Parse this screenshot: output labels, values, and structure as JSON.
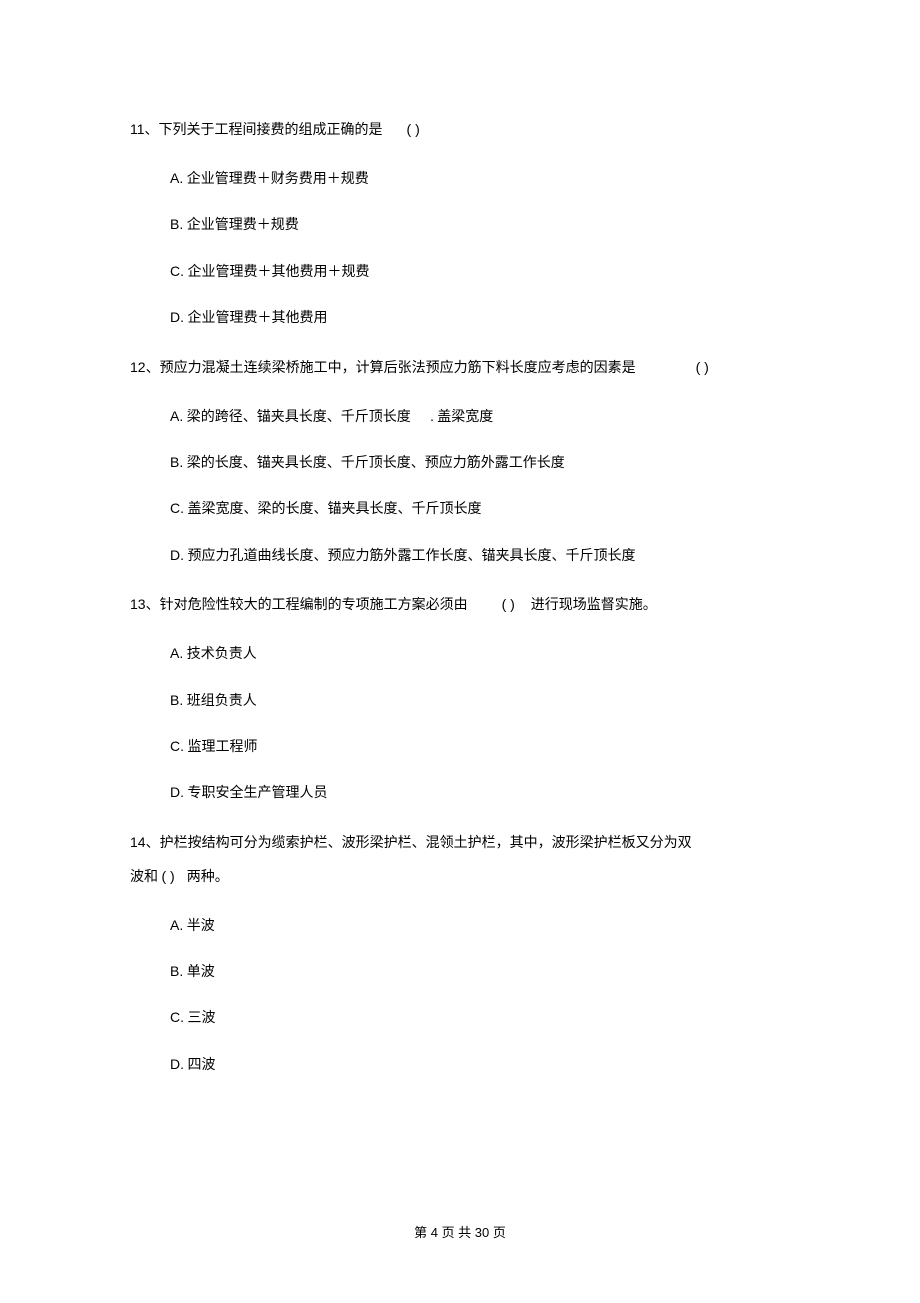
{
  "questions": [
    {
      "number": "11",
      "sep": "、",
      "stem_before": "下列关于工程间接费的组成正确的是",
      "blank": "(    )",
      "stem_after": "",
      "options": [
        {
          "letter": "A.",
          "text": "企业管理费＋财务费用＋规费"
        },
        {
          "letter": "B.",
          "text": "企业管理费＋规费"
        },
        {
          "letter": "C.",
          "text": "企业管理费＋其他费用＋规费"
        },
        {
          "letter": "D.",
          "text": "企业管理费＋其他费用"
        }
      ]
    },
    {
      "number": "12",
      "sep": "、",
      "stem_before": "预应力混凝土连续梁桥施工中，计算后张法预应力筋下料长度应考虑的因素是",
      "blank": "(    )",
      "stem_after": "",
      "options": [
        {
          "letter": "A.",
          "text": "梁的跨径、锚夹具长度、千斤顶长度",
          "extra": "   . 盖梁宽度"
        },
        {
          "letter": "B.",
          "text": "梁的长度、锚夹具长度、千斤顶长度、预应力筋外露工作长度"
        },
        {
          "letter": "C.",
          "text": "盖梁宽度、梁的长度、锚夹具长度、千斤顶长度"
        },
        {
          "letter": "D.",
          "text": "预应力孔道曲线长度、预应力筋外露工作长度、锚夹具长度、千斤顶长度"
        }
      ]
    },
    {
      "number": "13",
      "sep": "、",
      "stem_before": "针对危险性较大的工程编制的专项施工方案必须由",
      "blank": "(    )",
      "stem_after": "进行现场监督实施。",
      "options": [
        {
          "letter": "A.",
          "text": "技术负责人"
        },
        {
          "letter": "B.",
          "text": "班组负责人"
        },
        {
          "letter": "C.",
          "text": "监理工程师"
        },
        {
          "letter": "D.",
          "text": "专职安全生产管理人员"
        }
      ]
    },
    {
      "number": "14",
      "sep": "、",
      "stem_before": "护栏按结构可分为缆索护栏、波形梁护栏、混领土护栏，其中，波形梁护栏板又分为双",
      "line2_prefix": "波和",
      "blank": "(    )",
      "line2_suffix": "两种。",
      "options": [
        {
          "letter": "A.",
          "text": "半波"
        },
        {
          "letter": "B.",
          "text": "单波"
        },
        {
          "letter": "C.",
          "text": "三波"
        },
        {
          "letter": "D.",
          "text": "四波"
        }
      ]
    }
  ],
  "footer": {
    "prefix": "第 ",
    "current": "4",
    "middle": " 页 共 ",
    "total": "30",
    "suffix": " 页"
  }
}
